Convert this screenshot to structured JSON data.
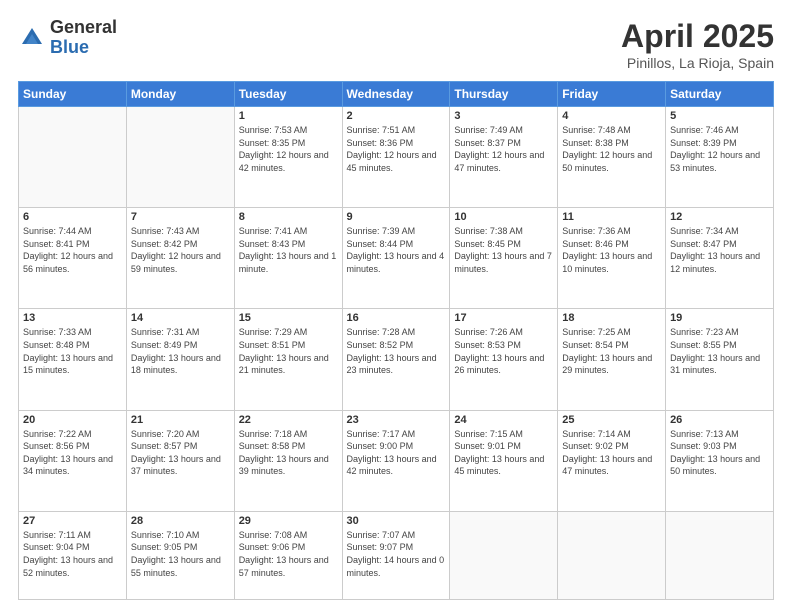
{
  "header": {
    "logo_general": "General",
    "logo_blue": "Blue",
    "title": "April 2025",
    "location": "Pinillos, La Rioja, Spain"
  },
  "weekdays": [
    "Sunday",
    "Monday",
    "Tuesday",
    "Wednesday",
    "Thursday",
    "Friday",
    "Saturday"
  ],
  "weeks": [
    [
      {
        "day": "",
        "sunrise": "",
        "sunset": "",
        "daylight": ""
      },
      {
        "day": "",
        "sunrise": "",
        "sunset": "",
        "daylight": ""
      },
      {
        "day": "1",
        "sunrise": "Sunrise: 7:53 AM",
        "sunset": "Sunset: 8:35 PM",
        "daylight": "Daylight: 12 hours and 42 minutes."
      },
      {
        "day": "2",
        "sunrise": "Sunrise: 7:51 AM",
        "sunset": "Sunset: 8:36 PM",
        "daylight": "Daylight: 12 hours and 45 minutes."
      },
      {
        "day": "3",
        "sunrise": "Sunrise: 7:49 AM",
        "sunset": "Sunset: 8:37 PM",
        "daylight": "Daylight: 12 hours and 47 minutes."
      },
      {
        "day": "4",
        "sunrise": "Sunrise: 7:48 AM",
        "sunset": "Sunset: 8:38 PM",
        "daylight": "Daylight: 12 hours and 50 minutes."
      },
      {
        "day": "5",
        "sunrise": "Sunrise: 7:46 AM",
        "sunset": "Sunset: 8:39 PM",
        "daylight": "Daylight: 12 hours and 53 minutes."
      }
    ],
    [
      {
        "day": "6",
        "sunrise": "Sunrise: 7:44 AM",
        "sunset": "Sunset: 8:41 PM",
        "daylight": "Daylight: 12 hours and 56 minutes."
      },
      {
        "day": "7",
        "sunrise": "Sunrise: 7:43 AM",
        "sunset": "Sunset: 8:42 PM",
        "daylight": "Daylight: 12 hours and 59 minutes."
      },
      {
        "day": "8",
        "sunrise": "Sunrise: 7:41 AM",
        "sunset": "Sunset: 8:43 PM",
        "daylight": "Daylight: 13 hours and 1 minute."
      },
      {
        "day": "9",
        "sunrise": "Sunrise: 7:39 AM",
        "sunset": "Sunset: 8:44 PM",
        "daylight": "Daylight: 13 hours and 4 minutes."
      },
      {
        "day": "10",
        "sunrise": "Sunrise: 7:38 AM",
        "sunset": "Sunset: 8:45 PM",
        "daylight": "Daylight: 13 hours and 7 minutes."
      },
      {
        "day": "11",
        "sunrise": "Sunrise: 7:36 AM",
        "sunset": "Sunset: 8:46 PM",
        "daylight": "Daylight: 13 hours and 10 minutes."
      },
      {
        "day": "12",
        "sunrise": "Sunrise: 7:34 AM",
        "sunset": "Sunset: 8:47 PM",
        "daylight": "Daylight: 13 hours and 12 minutes."
      }
    ],
    [
      {
        "day": "13",
        "sunrise": "Sunrise: 7:33 AM",
        "sunset": "Sunset: 8:48 PM",
        "daylight": "Daylight: 13 hours and 15 minutes."
      },
      {
        "day": "14",
        "sunrise": "Sunrise: 7:31 AM",
        "sunset": "Sunset: 8:49 PM",
        "daylight": "Daylight: 13 hours and 18 minutes."
      },
      {
        "day": "15",
        "sunrise": "Sunrise: 7:29 AM",
        "sunset": "Sunset: 8:51 PM",
        "daylight": "Daylight: 13 hours and 21 minutes."
      },
      {
        "day": "16",
        "sunrise": "Sunrise: 7:28 AM",
        "sunset": "Sunset: 8:52 PM",
        "daylight": "Daylight: 13 hours and 23 minutes."
      },
      {
        "day": "17",
        "sunrise": "Sunrise: 7:26 AM",
        "sunset": "Sunset: 8:53 PM",
        "daylight": "Daylight: 13 hours and 26 minutes."
      },
      {
        "day": "18",
        "sunrise": "Sunrise: 7:25 AM",
        "sunset": "Sunset: 8:54 PM",
        "daylight": "Daylight: 13 hours and 29 minutes."
      },
      {
        "day": "19",
        "sunrise": "Sunrise: 7:23 AM",
        "sunset": "Sunset: 8:55 PM",
        "daylight": "Daylight: 13 hours and 31 minutes."
      }
    ],
    [
      {
        "day": "20",
        "sunrise": "Sunrise: 7:22 AM",
        "sunset": "Sunset: 8:56 PM",
        "daylight": "Daylight: 13 hours and 34 minutes."
      },
      {
        "day": "21",
        "sunrise": "Sunrise: 7:20 AM",
        "sunset": "Sunset: 8:57 PM",
        "daylight": "Daylight: 13 hours and 37 minutes."
      },
      {
        "day": "22",
        "sunrise": "Sunrise: 7:18 AM",
        "sunset": "Sunset: 8:58 PM",
        "daylight": "Daylight: 13 hours and 39 minutes."
      },
      {
        "day": "23",
        "sunrise": "Sunrise: 7:17 AM",
        "sunset": "Sunset: 9:00 PM",
        "daylight": "Daylight: 13 hours and 42 minutes."
      },
      {
        "day": "24",
        "sunrise": "Sunrise: 7:15 AM",
        "sunset": "Sunset: 9:01 PM",
        "daylight": "Daylight: 13 hours and 45 minutes."
      },
      {
        "day": "25",
        "sunrise": "Sunrise: 7:14 AM",
        "sunset": "Sunset: 9:02 PM",
        "daylight": "Daylight: 13 hours and 47 minutes."
      },
      {
        "day": "26",
        "sunrise": "Sunrise: 7:13 AM",
        "sunset": "Sunset: 9:03 PM",
        "daylight": "Daylight: 13 hours and 50 minutes."
      }
    ],
    [
      {
        "day": "27",
        "sunrise": "Sunrise: 7:11 AM",
        "sunset": "Sunset: 9:04 PM",
        "daylight": "Daylight: 13 hours and 52 minutes."
      },
      {
        "day": "28",
        "sunrise": "Sunrise: 7:10 AM",
        "sunset": "Sunset: 9:05 PM",
        "daylight": "Daylight: 13 hours and 55 minutes."
      },
      {
        "day": "29",
        "sunrise": "Sunrise: 7:08 AM",
        "sunset": "Sunset: 9:06 PM",
        "daylight": "Daylight: 13 hours and 57 minutes."
      },
      {
        "day": "30",
        "sunrise": "Sunrise: 7:07 AM",
        "sunset": "Sunset: 9:07 PM",
        "daylight": "Daylight: 14 hours and 0 minutes."
      },
      {
        "day": "",
        "sunrise": "",
        "sunset": "",
        "daylight": ""
      },
      {
        "day": "",
        "sunrise": "",
        "sunset": "",
        "daylight": ""
      },
      {
        "day": "",
        "sunrise": "",
        "sunset": "",
        "daylight": ""
      }
    ]
  ]
}
